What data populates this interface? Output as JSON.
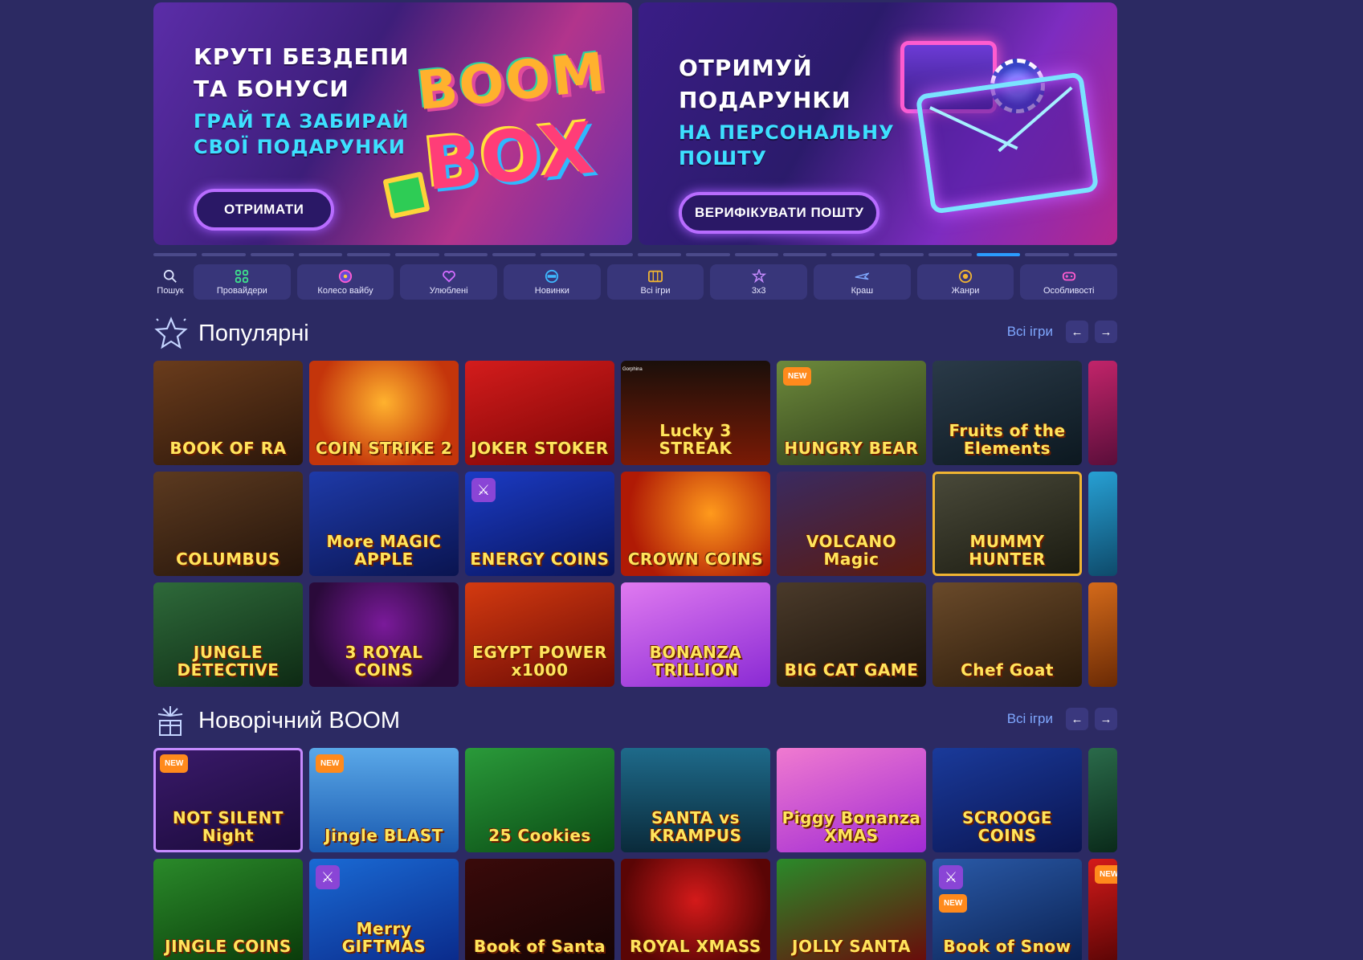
{
  "banners": [
    {
      "line1": "КРУТІ БЕЗДЕПИ",
      "line2": "ТА БОНУСИ",
      "line3": "ГРАЙ ТА ЗАБИРАЙ",
      "line4": "СВОЇ ПОДАРУНКИ",
      "cta": "ОТРИМАТИ",
      "art_word1": "BOOM",
      "art_word2": "BOX"
    },
    {
      "line1": "ОТРИМУЙ",
      "line2": "ПОДАРУНКИ",
      "line3": "НА ПЕРСОНАЛЬНУ",
      "line4": "ПОШТУ",
      "cta": "ВЕРИФІКУВАТИ ПОШТУ"
    }
  ],
  "pager": {
    "total": 20,
    "active_index": 17,
    "active_color": "#2b9bff"
  },
  "nav": [
    {
      "label": "Пошук",
      "icon": "search-icon"
    },
    {
      "label": "Провайдери",
      "icon": "grid-icon"
    },
    {
      "label": "Колесо вайбу",
      "icon": "wheel-icon"
    },
    {
      "label": "Улюблені",
      "icon": "heart-icon"
    },
    {
      "label": "Новинки",
      "icon": "new-icon"
    },
    {
      "label": "Всі ігри",
      "icon": "slot-icon"
    },
    {
      "label": "3х3",
      "icon": "star-cluster-icon"
    },
    {
      "label": "Краш",
      "icon": "plane-icon"
    },
    {
      "label": "Жанри",
      "icon": "target-icon"
    },
    {
      "label": "Особливості",
      "icon": "gamepad-icon"
    }
  ],
  "sections": {
    "popular": {
      "title": "Популярні",
      "all_label": "Всі ігри",
      "prev": "←",
      "next": "→",
      "rows": [
        [
          {
            "name": "BOOK OF RA",
            "bg": "linear-gradient(160deg,#6a3c1c,#2b160a)"
          },
          {
            "name": "COIN STRIKE 2",
            "bg": "radial-gradient(circle at 50% 40%,#ffb22e,#c4350b 70%)"
          },
          {
            "name": "JOKER STOKER",
            "bg": "linear-gradient(160deg,#d41c1c,#7a0505)"
          },
          {
            "name": "Lucky 3 STREAK",
            "bg": "linear-gradient(180deg,#1a0f0a,#7a1a05)",
            "sub": "Gorphina"
          },
          {
            "name": "HUNGRY BEAR",
            "bg": "linear-gradient(160deg,#6d8a3c,#2c3a18)",
            "badge": "NEW"
          },
          {
            "name": "Fruits of the Elements",
            "bg": "linear-gradient(160deg,#2a3a48,#0c1820)"
          },
          {
            "name": "",
            "bg": "linear-gradient(160deg,#c2246a,#5a0e3a)",
            "partial": true
          }
        ],
        [
          {
            "name": "COLUMBUS",
            "bg": "linear-gradient(160deg,#5c3a20,#24140a)"
          },
          {
            "name": "More MAGIC APPLE",
            "bg": "linear-gradient(160deg,#1e3aa8,#0a1450)"
          },
          {
            "name": "ENERGY COINS",
            "bg": "linear-gradient(160deg,#1b3bc4,#08135a)",
            "badge_x": true
          },
          {
            "name": "CROWN COINS",
            "bg": "radial-gradient(circle at 60% 40%,#ff9a1c,#b01a05 75%)"
          },
          {
            "name": "VOLCANO Magic",
            "bg": "linear-gradient(160deg,#3a2a60,#5a1a10)"
          },
          {
            "name": "MUMMY HUNTER",
            "bg": "linear-gradient(160deg,#4a4a3a,#1a1a10)",
            "selected": true
          },
          {
            "name": "",
            "bg": "linear-gradient(160deg,#27a0d4,#0e4a6a)",
            "partial": true
          }
        ],
        [
          {
            "name": "JUNGLE DETECTIVE",
            "bg": "linear-gradient(160deg,#2e6a3a,#0e2a14)"
          },
          {
            "name": "3 ROYAL COINS",
            "bg": "radial-gradient(circle at 50% 40%,#7a1a9a,#2a0a3a 75%)"
          },
          {
            "name": "EGYPT POWER x1000",
            "bg": "linear-gradient(160deg,#d43a10,#6a0a05)"
          },
          {
            "name": "BONANZA TRILLION",
            "bg": "linear-gradient(160deg,#e07af0,#8a2ad4)"
          },
          {
            "name": "BIG CAT GAME",
            "bg": "linear-gradient(160deg,#4a3a2a,#1a120a)"
          },
          {
            "name": "Chef Goat",
            "bg": "linear-gradient(160deg,#6a4a2a,#2a1a0a)"
          },
          {
            "name": "",
            "bg": "linear-gradient(160deg,#d46a1a,#6a2a05)",
            "partial": true
          }
        ]
      ]
    },
    "newyear": {
      "title": "Новорічний BOOM",
      "all_label": "Всі ігри",
      "prev": "←",
      "next": "→",
      "rows": [
        [
          {
            "name": "NOT SILENT Night",
            "bg": "linear-gradient(160deg,#3a1a6a,#1a0a3a)",
            "badge": "NEW",
            "selected2": true
          },
          {
            "name": "Jingle BLAST",
            "bg": "linear-gradient(180deg,#5aa8e8,#1a5ab0)",
            "badge": "NEW"
          },
          {
            "name": "25 Cookies",
            "bg": "linear-gradient(160deg,#2a9a3a,#0a4a14)"
          },
          {
            "name": "SANTA vs KRAMPUS",
            "bg": "linear-gradient(180deg,#1e6a8a,#0a2a3a)"
          },
          {
            "name": "Piggy Bonanza XMAS",
            "bg": "linear-gradient(160deg,#f07ad0,#a02ad4)"
          },
          {
            "name": "SCROOGE COINS",
            "bg": "linear-gradient(160deg,#1a3a9a,#0a1450)"
          },
          {
            "name": "",
            "bg": "linear-gradient(160deg,#2a6a4a,#0a2a1a)",
            "partial": true
          }
        ],
        [
          {
            "name": "JINGLE COINS",
            "bg": "linear-gradient(160deg,#2a8a2a,#0a3a0a)"
          },
          {
            "name": "Merry GIFTMAS",
            "bg": "linear-gradient(160deg,#1a6ad4,#0a2a8a)",
            "badge_x": true
          },
          {
            "name": "Book of Santa",
            "bg": "linear-gradient(160deg,#3a0a0a,#150404)"
          },
          {
            "name": "ROYAL XMASS",
            "bg": "radial-gradient(circle at 50% 40%,#d41a1a,#5a0505 75%)"
          },
          {
            "name": "JOLLY SANTA",
            "bg": "linear-gradient(160deg,#2a8a2a,#6a0a0a)"
          },
          {
            "name": "Book of Snow",
            "bg": "linear-gradient(160deg,#2a5aa8,#0a2050)",
            "badge_x": true,
            "badge": "NEW",
            "badge_below": true
          },
          {
            "name": "",
            "bg": "linear-gradient(160deg,#d41a1a,#5a0505)",
            "partial": true,
            "badge": "NEW"
          }
        ]
      ]
    }
  },
  "colors": {
    "page_bg": "#2c2a63",
    "nav_bg": "#38367a",
    "link": "#7fa8ff",
    "badge_new": "#ff8a1c",
    "badge_feature": "#8a45d6"
  }
}
